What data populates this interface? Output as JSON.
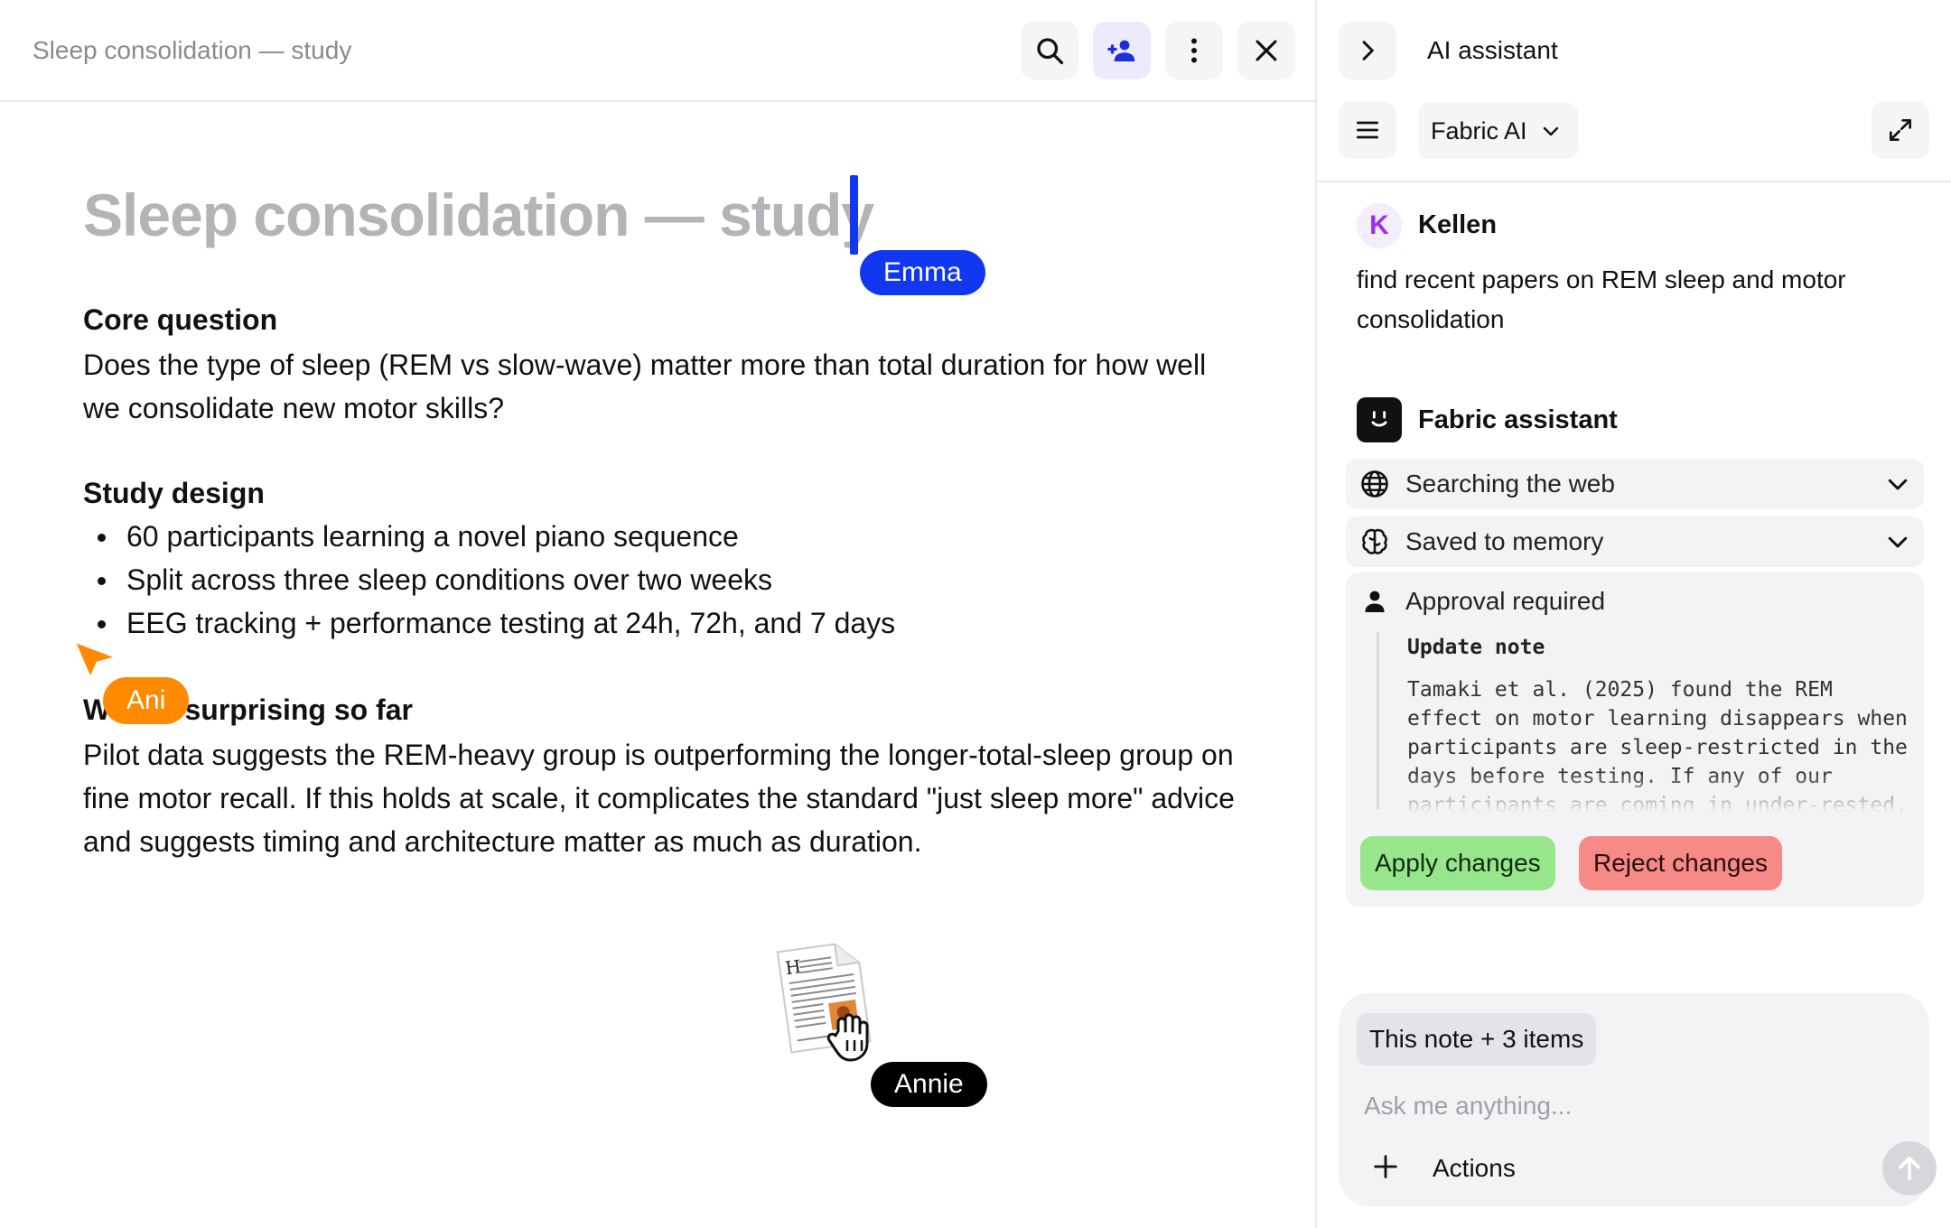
{
  "note": {
    "breadcrumb": "Sleep consolidation — study",
    "title": "Sleep consolidation — study",
    "sections": {
      "core_question": {
        "heading": "Core question",
        "body": "Does the type of sleep (REM vs slow-wave) matter more than total duration for how well we consolidate new motor skills?"
      },
      "study_design": {
        "heading": "Study design",
        "bullets": [
          "60 participants learning a novel piano sequence",
          "Split across three sleep conditions over two weeks",
          "EEG tracking + performance testing at 24h, 72h, and 7 days"
        ]
      },
      "surprising": {
        "heading": "What's surprising so far",
        "body": "Pilot data suggests the REM-heavy group is outperforming the longer-total-sleep group on fine motor recall. If this holds at scale, it complicates the standard \"just sleep more\" advice and suggests timing and architecture matter as much as duration."
      }
    }
  },
  "collaborators": {
    "emma": {
      "name": "Emma",
      "color": "#1138f0"
    },
    "ani": {
      "name": "Ani",
      "color": "#ff8a00"
    },
    "annie": {
      "name": "Annie",
      "color": "#000000"
    }
  },
  "header_icons": [
    "search-icon",
    "add-person-icon",
    "more-vertical-icon",
    "close-icon"
  ],
  "assistant": {
    "title": "AI assistant",
    "model": "Fabric AI",
    "user": {
      "initial": "K",
      "name": "Kellen",
      "message": "find recent papers on REM sleep and motor consolidation"
    },
    "bot": {
      "name": "Fabric assistant",
      "steps": [
        {
          "label": "Searching the web",
          "icon": "globe-icon"
        },
        {
          "label": "Saved to memory",
          "icon": "brain-icon"
        }
      ],
      "approval": {
        "label": "Approval required",
        "update_title": "Update note",
        "update_body": "Tamaki et al. (2025) found the REM effect on motor learning disappears when participants are sleep-restricted in the days before testing. If any of our participants are coming in under-rested, the results could be skewed.",
        "apply_label": "Apply changes",
        "reject_label": "Reject changes"
      }
    },
    "composer": {
      "context_chip": "This note + 3 items",
      "placeholder": "Ask me anything...",
      "actions_label": "Actions"
    }
  },
  "colors": {
    "accent": "#1138f0",
    "apply": "#98e68c",
    "reject": "#f58a86",
    "selected_button": "#ecebfb"
  }
}
